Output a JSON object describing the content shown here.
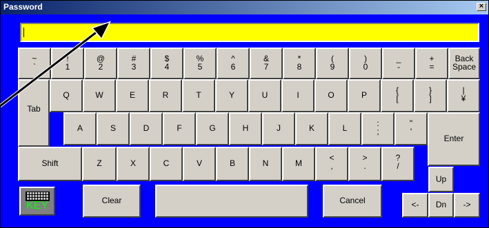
{
  "window": {
    "title": "Password",
    "close_glyph": "×"
  },
  "password_field": {
    "value": ""
  },
  "keys": {
    "tilde": {
      "top": "~",
      "bottom": "`"
    },
    "k1": {
      "top": "!",
      "bottom": "1"
    },
    "k2": {
      "top": "@",
      "bottom": "2"
    },
    "k3": {
      "top": "#",
      "bottom": "3"
    },
    "k4": {
      "top": "$",
      "bottom": "4"
    },
    "k5": {
      "top": "%",
      "bottom": "5"
    },
    "k6": {
      "top": "^",
      "bottom": "6"
    },
    "k7": {
      "top": "&",
      "bottom": "7"
    },
    "k8": {
      "top": "*",
      "bottom": "8"
    },
    "k9": {
      "top": "(",
      "bottom": "9"
    },
    "k0": {
      "top": ")",
      "bottom": "0"
    },
    "minus": {
      "top": "_",
      "bottom": "-"
    },
    "equal": {
      "top": "+",
      "bottom": "="
    },
    "backspace": {
      "top": "Back",
      "bottom": "Space"
    },
    "tab": "Tab",
    "q": "Q",
    "w": "W",
    "e": "E",
    "r": "R",
    "t": "T",
    "y": "Y",
    "u": "U",
    "i": "I",
    "o": "O",
    "p": "P",
    "lbrace": {
      "top": "{",
      "bottom": "["
    },
    "rbrace": {
      "top": "}",
      "bottom": "]"
    },
    "pipe": {
      "top": "|",
      "bottom": "¥"
    },
    "a": "A",
    "s": "S",
    "d": "D",
    "f": "F",
    "g": "G",
    "h": "H",
    "j": "J",
    "k": "K",
    "l": "L",
    "semicolon": {
      "top": ":",
      "bottom": ";"
    },
    "quote": {
      "top": "\"",
      "bottom": "'"
    },
    "enter": "Enter",
    "shift": "Shift",
    "z": "Z",
    "x": "X",
    "c": "C",
    "v": "V",
    "b": "B",
    "n": "N",
    "m": "M",
    "comma": {
      "top": "<",
      "bottom": ","
    },
    "period": {
      "top": ">",
      "bottom": "."
    },
    "slash": {
      "top": "?",
      "bottom": "/"
    },
    "up": "Up",
    "clear": "Clear",
    "space": "",
    "cancel": "Cancel",
    "left": "<-",
    "down": "Dn",
    "right": "->"
  },
  "logo": {
    "text": "KEY"
  },
  "colors": {
    "background": "#0000ff",
    "field": "#ffff00",
    "key_face": "#d4d0c8",
    "logo_text": "#00ff00"
  }
}
